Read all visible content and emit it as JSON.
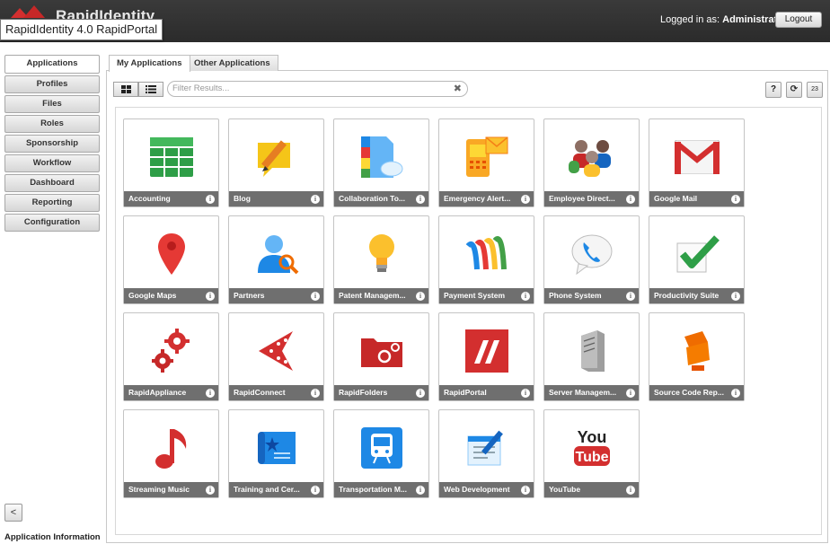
{
  "header": {
    "logo_text": "RapidIdentity",
    "logged_in_prefix": "Logged in as:",
    "logged_in_user": "Administrator",
    "logout_label": "Logout",
    "tooltip": "RapidIdentity 4.0 RapidPortal"
  },
  "nav": {
    "items": [
      {
        "label": "Applications"
      },
      {
        "label": "Profiles"
      },
      {
        "label": "Files"
      },
      {
        "label": "Roles"
      },
      {
        "label": "Sponsorship"
      },
      {
        "label": "Workflow"
      },
      {
        "label": "Dashboard"
      },
      {
        "label": "Reporting"
      },
      {
        "label": "Configuration"
      }
    ],
    "collapse_label": "<",
    "footer_label": "Application Information"
  },
  "tabs": {
    "my_apps": "My Applications",
    "other_apps": "Other Applications"
  },
  "toolbar": {
    "search_placeholder": "Filter Results...",
    "search_clear": "✖",
    "help_label": "?",
    "refresh_label": "⟳",
    "count_label": "23"
  },
  "apps": [
    {
      "label": "Accounting",
      "icon": "spreadsheet-icon"
    },
    {
      "label": "Blog",
      "icon": "pencil-note-icon"
    },
    {
      "label": "Collaboration To...",
      "icon": "cloud-docs-icon"
    },
    {
      "label": "Emergency Alert...",
      "icon": "mobile-mail-icon"
    },
    {
      "label": "Employee Direct...",
      "icon": "people-icon"
    },
    {
      "label": "Google Mail",
      "icon": "gmail-icon"
    },
    {
      "label": "Google Maps",
      "icon": "map-pin-icon"
    },
    {
      "label": "Partners",
      "icon": "user-search-icon"
    },
    {
      "label": "Patent Managem...",
      "icon": "lightbulb-icon"
    },
    {
      "label": "Payment System",
      "icon": "wallet-icon"
    },
    {
      "label": "Phone System",
      "icon": "phone-bubble-icon"
    },
    {
      "label": "Productivity Suite",
      "icon": "checkmark-icon"
    },
    {
      "label": "RapidAppliance",
      "icon": "gears-icon"
    },
    {
      "label": "RapidConnect",
      "icon": "connect-icon"
    },
    {
      "label": "RapidFolders",
      "icon": "folder-gears-icon"
    },
    {
      "label": "RapidPortal",
      "icon": "rapidportal-icon"
    },
    {
      "label": "Server Managem...",
      "icon": "server-icon"
    },
    {
      "label": "Source Code Rep...",
      "icon": "source-code-icon"
    },
    {
      "label": "Streaming Music",
      "icon": "music-note-icon"
    },
    {
      "label": "Training and Cer...",
      "icon": "certificate-icon"
    },
    {
      "label": "Transportation M...",
      "icon": "train-icon"
    },
    {
      "label": "Web Development",
      "icon": "web-dev-icon"
    },
    {
      "label": "YouTube",
      "icon": "youtube-icon"
    }
  ],
  "colors": {
    "header_bg": "#2f2f2f",
    "tile_bar": "#6f6f6f",
    "brand_red": "#d32f2f"
  }
}
